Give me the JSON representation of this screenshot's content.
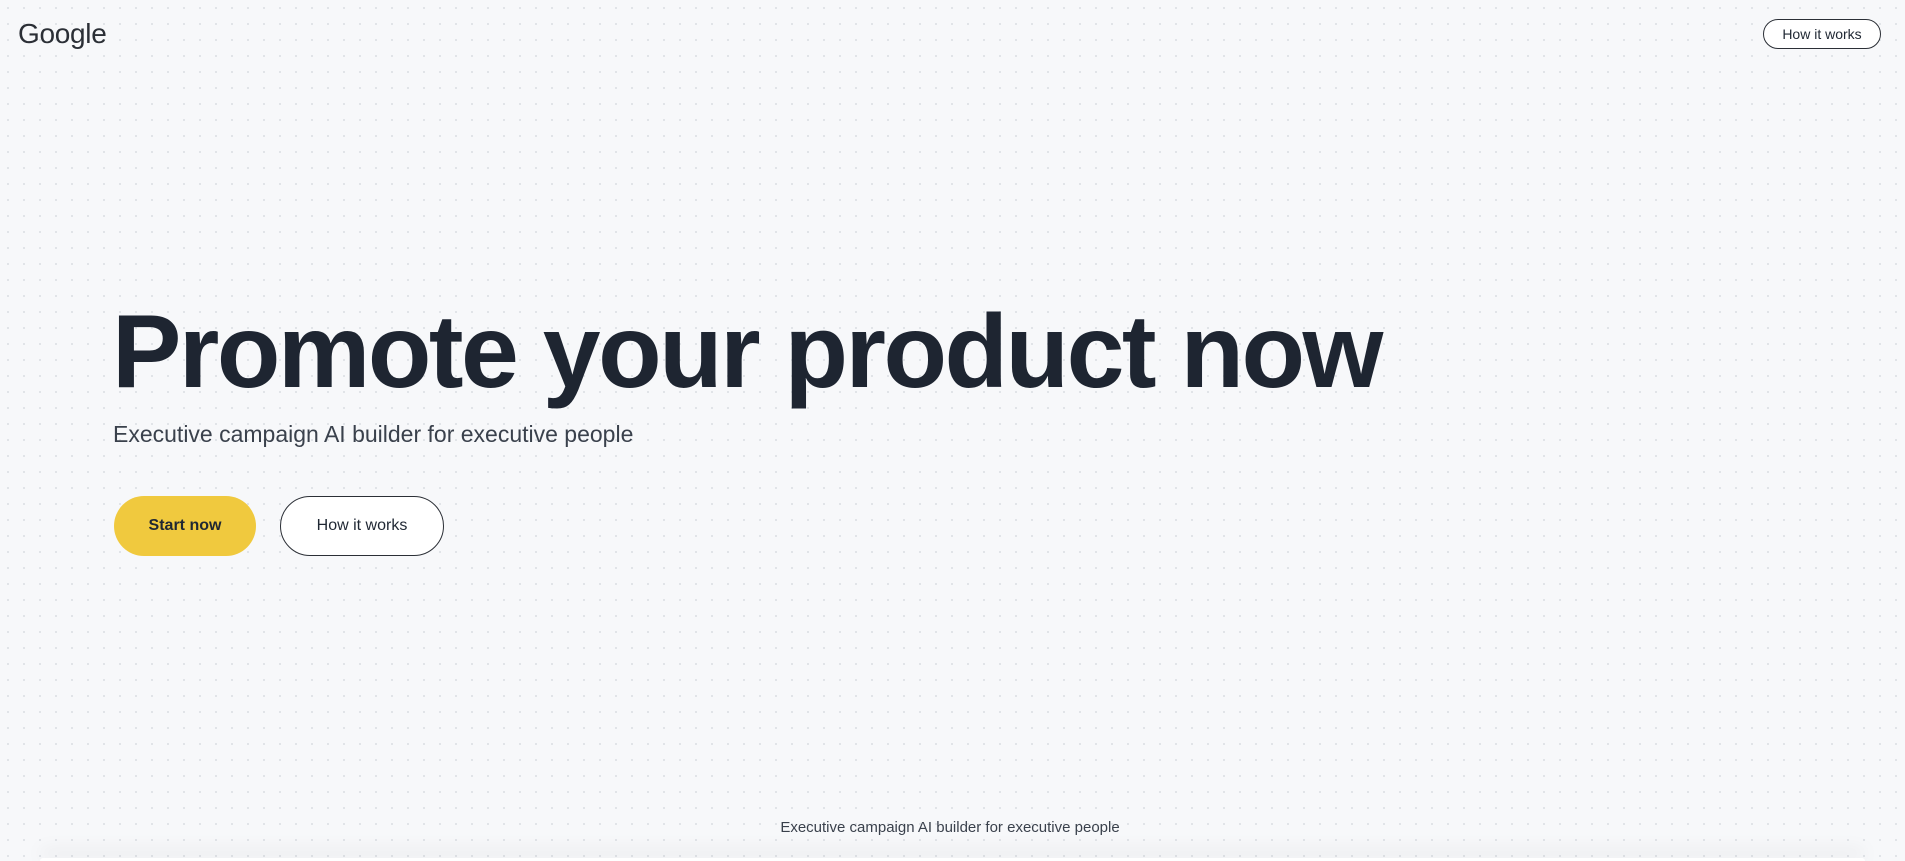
{
  "header": {
    "logo_text": "Google",
    "nav_button_label": "How it works"
  },
  "hero": {
    "title": "Promote your product now",
    "subtitle": "Executive campaign AI builder for executive people",
    "primary_button_label": "Start now",
    "secondary_button_label": "How it works"
  },
  "footer": {
    "text": "Executive campaign AI builder for executive people"
  },
  "colors": {
    "background": "#f7f8fa",
    "primary_button": "#f0c93e",
    "text_dark": "#1e2531"
  }
}
